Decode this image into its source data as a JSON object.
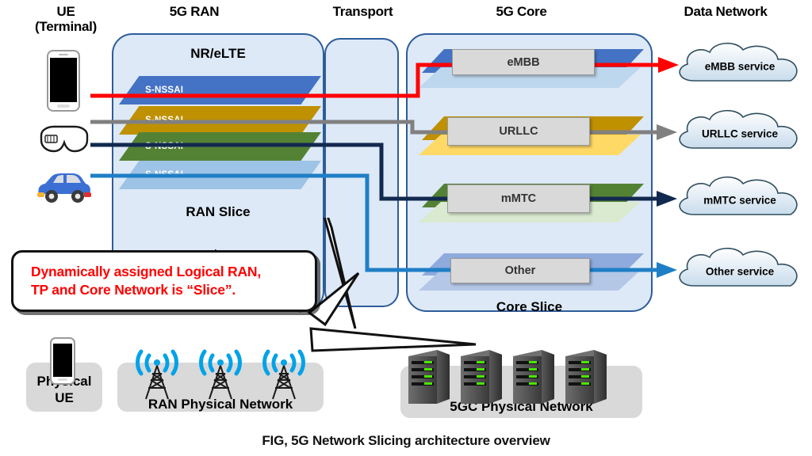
{
  "figure": {
    "caption": "FIG, 5G Network Slicing architecture overview"
  },
  "columns": [
    {
      "id": "ue",
      "label": "UE\n(Terminal)"
    },
    {
      "id": "ran",
      "label": "5G RAN"
    },
    {
      "id": "transport",
      "label": "Transport"
    },
    {
      "id": "core",
      "label": "5G Core"
    },
    {
      "id": "data_network",
      "label": "Data Network"
    }
  ],
  "ran": {
    "top_label": "NR/eLTE",
    "bottom_label": "RAN Slice",
    "slices": [
      {
        "name": "S-NSSAI",
        "color": "#4472C4",
        "icon": "parallelogram-slab"
      },
      {
        "name": "S-NSSAI",
        "color": "#BF9000",
        "icon": "parallelogram-slab"
      },
      {
        "name": "S-NSSAI",
        "color": "#548235",
        "icon": "parallelogram-slab"
      },
      {
        "name": "S-NSSAI",
        "color": "#9DC3E6",
        "icon": "parallelogram-slab"
      }
    ]
  },
  "core": {
    "bottom_label": "Core Slice",
    "functions": [
      {
        "name": "eMBB",
        "slab_dark": "#4472C4",
        "slab_light": "#BDD7EE"
      },
      {
        "name": "URLLC",
        "slab_dark": "#BF9000",
        "slab_light": "#FFD966"
      },
      {
        "name": "mMTC",
        "slab_dark": "#548235",
        "slab_light": "#C5E0B4"
      },
      {
        "name": "Other",
        "slab_dark": "#8FAADC",
        "slab_light": "#B4C7E7"
      }
    ]
  },
  "data_network": {
    "services": [
      {
        "name": "eMBB service",
        "arrow_color": "#FF0000"
      },
      {
        "name": "URLLC service",
        "arrow_color": "#808080"
      },
      {
        "name": "mMTC service",
        "arrow_color": "#12294F"
      },
      {
        "name": "Other service",
        "arrow_color": "#1F7FC6"
      }
    ]
  },
  "ue_devices": [
    {
      "icon": "smartphone-icon"
    },
    {
      "icon": "ar-glasses-icon"
    },
    {
      "icon": "car-icon"
    }
  ],
  "flows": [
    {
      "service": "eMBB",
      "color": "#FF0000"
    },
    {
      "service": "URLLC",
      "color": "#808080"
    },
    {
      "service": "mMTC",
      "color": "#12294F"
    },
    {
      "service": "Other",
      "color": "#1F7FC6"
    }
  ],
  "callout": {
    "line1": "Dynamically assigned Logical RAN,",
    "line2": "TP and Core Network is “Slice”.",
    "text_color": "#FF0000"
  },
  "physical": {
    "ue": {
      "label": "Physical\nUE",
      "icon": "smartphone-icon"
    },
    "ran": {
      "label": "RAN Physical  Network",
      "icon": "cell-tower-icon",
      "count": 3
    },
    "core": {
      "label": "5GC Physical  Network",
      "icon": "server-rack-icon",
      "count": 4
    }
  },
  "colors": {
    "domain_fill": "#DDE9F7",
    "domain_border": "#2E5C9A",
    "nf_fill": "#D9D9D9",
    "pill_fill": "#D9D9D9"
  }
}
